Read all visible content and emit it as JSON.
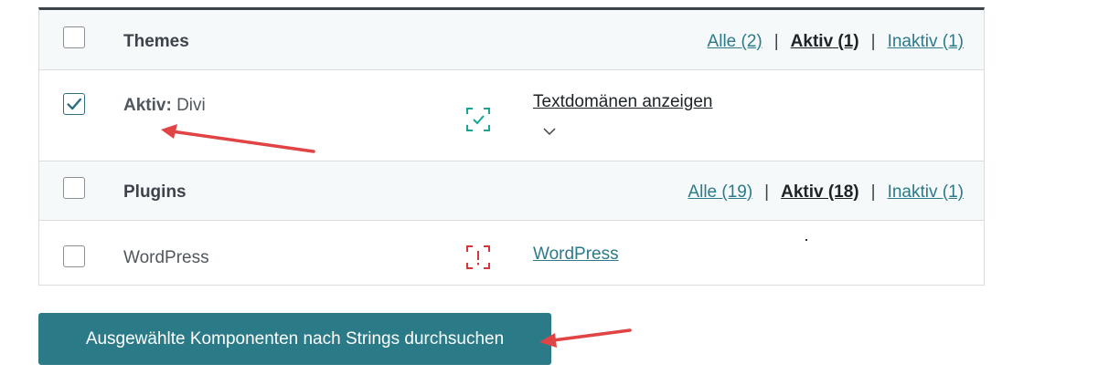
{
  "themes": {
    "title": "Themes",
    "filters": {
      "all": "Alle (2)",
      "active": "Aktiv (1)",
      "inactive": "Inaktiv (1)"
    },
    "item": {
      "label": "Aktiv:",
      "name": "Divi",
      "checked": true,
      "status_icon": "check-scan-icon",
      "status_color": "#1aa693",
      "link": "Textdomänen anzeigen"
    }
  },
  "plugins": {
    "title": "Plugins",
    "filters": {
      "all": "Alle (19)",
      "active": "Aktiv (18)",
      "inactive": "Inaktiv (1)"
    },
    "item": {
      "name": "WordPress",
      "checked": false,
      "status_icon": "warning-scan-icon",
      "status_color": "#d63638",
      "link": "WordPress"
    }
  },
  "action": {
    "scan_label": "Ausgewählte Komponenten nach Strings durchsuchen"
  },
  "colors": {
    "primary": "#2b7a87",
    "link": "#2c7a8a",
    "annotation": "#e04444"
  }
}
